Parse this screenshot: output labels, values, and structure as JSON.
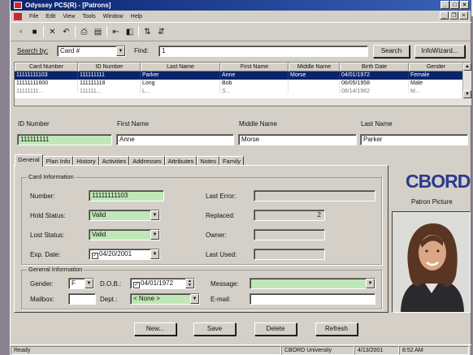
{
  "window": {
    "title": "Odyssey PCS(R) - [Patrons]"
  },
  "menu": [
    "File",
    "Edit",
    "View",
    "Tools",
    "Window",
    "Help"
  ],
  "toolbar_icons": [
    "new-icon",
    "save-icon",
    "delete-icon",
    "undo-icon",
    "print-icon",
    "print-preview-icon",
    "first-icon",
    "previous-icon",
    "next-icon",
    "sort-ascending-icon",
    "sort-descending-icon"
  ],
  "search": {
    "by_label": "Search by:",
    "by_value": "Card #",
    "find_label": "Find:",
    "find_value": "1",
    "search_button": "Search",
    "infowizard_button": "InfoWizard..."
  },
  "grid": {
    "columns": [
      "Card Number",
      "ID Number",
      "Last Name",
      "First Name",
      "Middle Name",
      "Birth Date",
      "Gender"
    ],
    "rows": [
      [
        "11111111103",
        "111111111",
        "Parker",
        "Anne",
        "Morse",
        "04/01/1972",
        "Female"
      ],
      [
        "11111111600",
        "111111118",
        "Long",
        "Bob",
        "",
        "06/05/1958",
        "Male"
      ],
      [
        "11111111...",
        "111111...",
        "L...",
        "S...",
        "",
        "08/14/1962",
        "M..."
      ]
    ]
  },
  "header_fields": {
    "id_label": "ID Number",
    "id_value": "111111111",
    "first_label": "First Name",
    "first_value": "Anne",
    "middle_label": "Middle Name",
    "middle_value": "Morse",
    "last_label": "Last Name",
    "last_value": "Parker"
  },
  "tabs": [
    "General",
    "Plan Info",
    "History",
    "Activities",
    "Addresses",
    "Attributes",
    "Notes",
    "Family"
  ],
  "card_info": {
    "title": "Card Information",
    "number_label": "Number:",
    "number_value": "11111111103",
    "hold_label": "Hold Status:",
    "hold_value": "Valid",
    "lost_label": "Lost Status:",
    "lost_value": "Valid",
    "exp_label": "Exp. Date:",
    "exp_value": "04/20/2001",
    "last_error_label": "Last Error:",
    "last_error_value": "",
    "replaced_label": "Replaced:",
    "replaced_value": "2",
    "owner_label": "Owner:",
    "owner_value": "",
    "last_used_label": "Last Used:",
    "last_used_value": ""
  },
  "general_info": {
    "title": "General Information",
    "gender_label": "Gender:",
    "gender_value": "F",
    "dob_label": "D.O.B.:",
    "dob_value": "04/01/1972",
    "message_label": "Message:",
    "message_value": "",
    "mailbox_label": "Mailbox:",
    "mailbox_value": "",
    "dept_label": "Dept.:",
    "dept_value": "< None >",
    "email_label": "E-mail:",
    "email_value": ""
  },
  "brand": {
    "logo": "CBORD",
    "photo_label": "Patron Picture",
    "logo_color": "#2c3a8c"
  },
  "actions": {
    "new": "New...",
    "save": "Save",
    "delete": "Delete",
    "refresh": "Refresh"
  },
  "status": {
    "left": "Ready",
    "org": "CBORD University",
    "date": "4/13/2001",
    "time": "8:52 AM"
  },
  "colors": {
    "titlebar": "#0a2470",
    "selection": "#0a246a",
    "required_field": "#bfe7b7"
  }
}
